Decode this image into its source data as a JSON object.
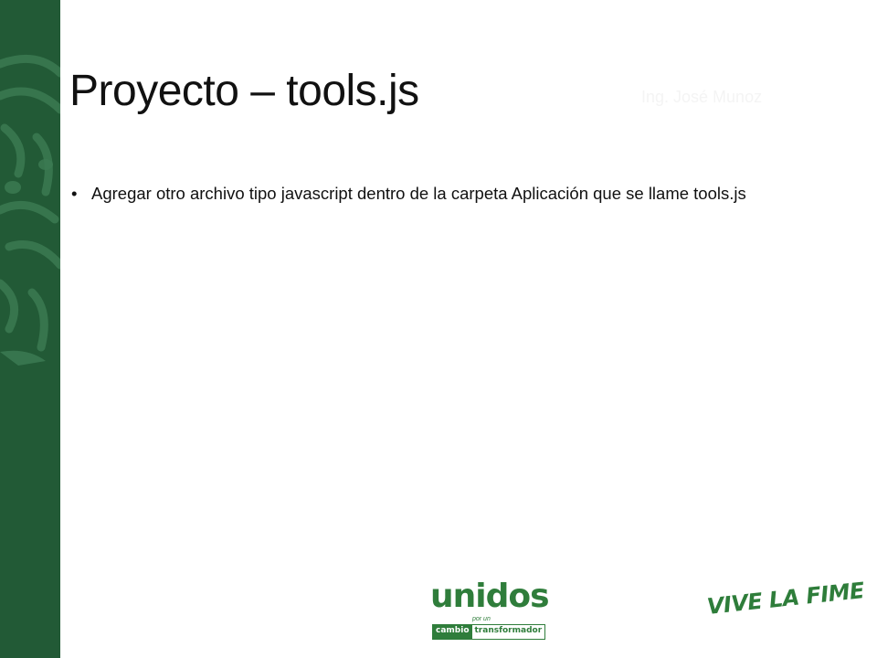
{
  "slide": {
    "title": "Proyecto – tools.js",
    "author": "Ing. José Munoz",
    "bullets": [
      "Agregar otro archivo tipo javascript dentro de la carpeta Aplicación que se llame tools.js"
    ]
  },
  "logos": {
    "unidos_word": "unidos",
    "unidos_small": "por un",
    "unidos_cambio": "cambio",
    "unidos_transformador": "transformador",
    "vive": "VIVE LA FIME"
  },
  "colors": {
    "sidebar": "#225a36",
    "brand_green": "#2f7d3b"
  },
  "icons": {
    "sidebar_watermark": "tiger-head-icon",
    "bullet": "bullet-dot-icon"
  }
}
